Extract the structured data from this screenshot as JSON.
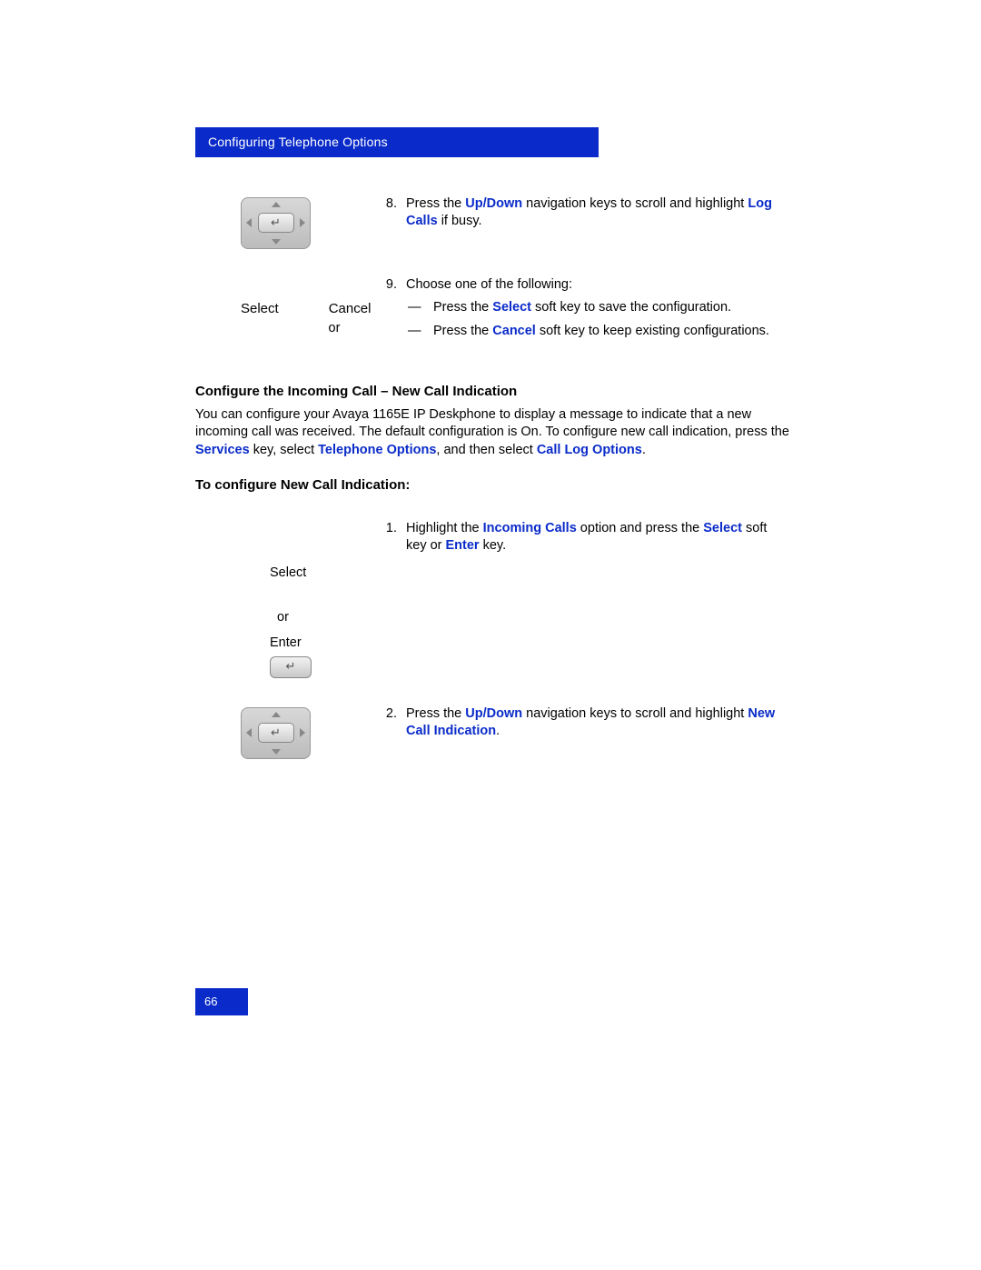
{
  "header": "Configuring Telephone Options",
  "page_number": "66",
  "step8": {
    "pre": "Press the ",
    "b1": "Up/Down",
    "mid": " navigation keys to scroll and highlight ",
    "b2": "Log Calls",
    "post": " if busy."
  },
  "softkeys": {
    "select": "Select",
    "cancel": "Cancel",
    "or": "or"
  },
  "step9": {
    "intro": "Choose one of the following:",
    "a_pre": "Press the ",
    "a_b": "Select",
    "a_post": " soft key to save the configuration.",
    "b_pre": "Press the ",
    "b_b": "Cancel",
    "b_post": " soft key to keep existing configurations."
  },
  "dash": "—",
  "heading1": "Configure the Incoming Call – New Call Indication",
  "para1_pre": "You can configure your Avaya 1165E IP Deskphone to display a message to indicate that a new incoming call was received. The default configuration is On. To configure new call indication, press the ",
  "para1_b1": "Services",
  "para1_mid1": " key, select ",
  "para1_b2": "Telephone Options",
  "para1_mid2": ", and then select ",
  "para1_b3": "Call Log Options",
  "para1_post": ".",
  "heading2": "To configure New Call Indication:",
  "step_nc1": {
    "pre": "Highlight the ",
    "b1": "Incoming Calls",
    "mid": " option and press the ",
    "b2": "Select",
    "mid2": " soft key or ",
    "b3": "Enter",
    "post": " key."
  },
  "selectEnter": {
    "select": "Select",
    "or": "or",
    "enter": "Enter"
  },
  "step_nc2": {
    "pre": "Press the ",
    "b1": "Up/Down",
    "mid": " navigation keys to scroll and highlight ",
    "b2": "New Call Indication",
    "post": "."
  }
}
